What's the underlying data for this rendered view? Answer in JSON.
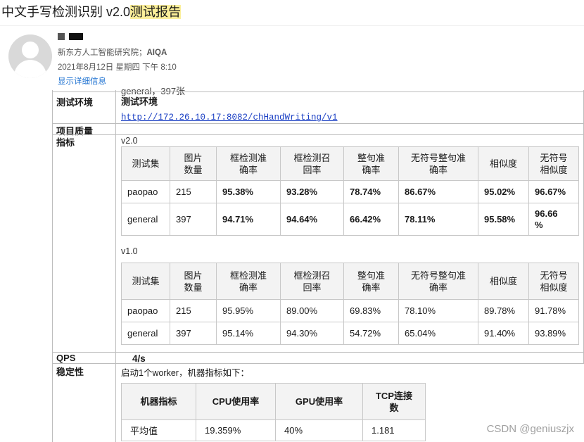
{
  "title": {
    "main": "中文手写检测识别 v2.0",
    "highlight": "测试报告"
  },
  "email": {
    "recipients_prefix": "新东方人工智能研究院；",
    "recipients_bold": "AIQA",
    "datetime": "2021年8月12日 星期四 下午 8:10",
    "detail_link": "显示详细信息"
  },
  "report": {
    "cut_text": "general，397张",
    "env": {
      "label": "测试环境",
      "title": "测试环境",
      "link": "http://172.26.10.17:8082/chHandWriting/v1"
    },
    "quality_label": "项目质量",
    "metrics_label": "指标",
    "tables": [
      {
        "version": "v2.0",
        "headers": [
          "测试集",
          "图片\n数量",
          "框检测准\n确率",
          "框检测召\n回率",
          "整句准\n确率",
          "无符号整句准\n确率",
          "相似度",
          "无符号\n相似度"
        ],
        "rows": [
          [
            "paopao",
            "215",
            "95.38%",
            "93.28%",
            "78.74%",
            "86.67%",
            "95.02%",
            "96.67%"
          ],
          [
            "general",
            "397",
            "94.71%",
            "94.64%",
            "66.42%",
            "78.11%",
            "95.58%",
            "96.66\n%"
          ]
        ]
      },
      {
        "version": "v1.0",
        "headers": [
          "测试集",
          "图片\n数量",
          "框检测准\n确率",
          "框检测召\n回率",
          "整句准\n确率",
          "无符号整句准\n确率",
          "相似度",
          "无符号\n相似度"
        ],
        "rows": [
          [
            "paopao",
            "215",
            "95.95%",
            "89.00%",
            "69.83%",
            "78.10%",
            "89.78%",
            "91.78%"
          ],
          [
            "general",
            "397",
            "95.14%",
            "94.30%",
            "54.72%",
            "65.04%",
            "91.40%",
            "93.89%"
          ]
        ]
      }
    ],
    "qps": {
      "label": "QPS",
      "value": "4/s"
    },
    "stability": {
      "label": "稳定性",
      "text": "启动1个worker，机器指标如下：",
      "headers": [
        "机器指标",
        "CPU使用率",
        "GPU使用率",
        "TCP连接\n数"
      ],
      "row": [
        "平均值",
        "19.359%",
        "40%",
        "1.181"
      ]
    }
  },
  "watermark": "CSDN @geniuszjx"
}
